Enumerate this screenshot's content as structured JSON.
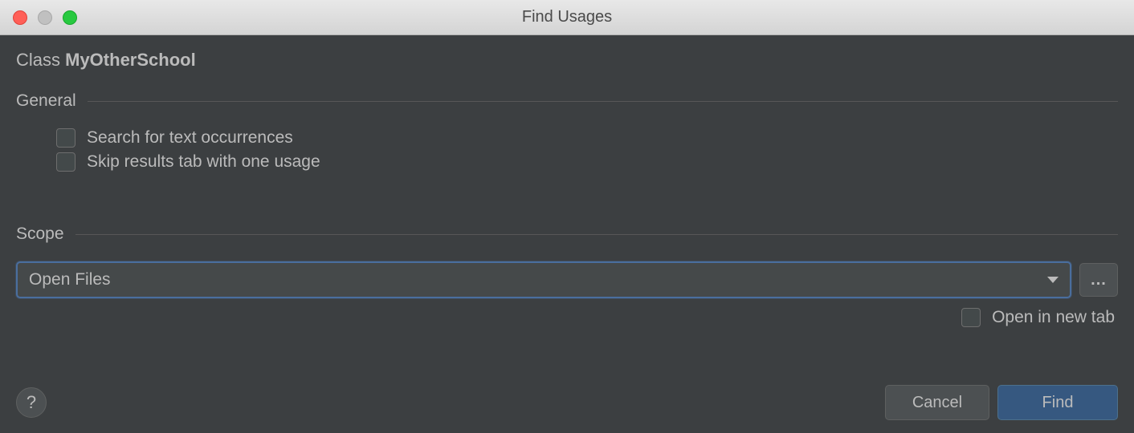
{
  "window": {
    "title": "Find Usages"
  },
  "classLine": {
    "prefix": "Class ",
    "name": "MyOtherSchool"
  },
  "sections": {
    "general": {
      "label": "General",
      "options": {
        "searchText": {
          "label": "Search for text occurrences",
          "checked": false
        },
        "skipResults": {
          "label": "Skip results tab with one usage",
          "checked": false
        }
      }
    },
    "scope": {
      "label": "Scope",
      "selected": "Open Files",
      "ellipsis": "..."
    }
  },
  "openInNewTab": {
    "label": "Open in new tab",
    "checked": false
  },
  "footer": {
    "help": "?",
    "cancel": "Cancel",
    "find": "Find"
  }
}
